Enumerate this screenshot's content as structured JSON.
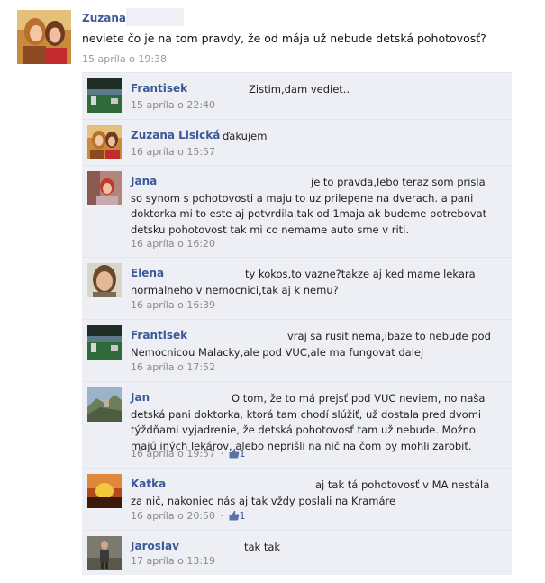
{
  "post": {
    "author": "Zuzana",
    "text": "neviete čo je na tom pravdy, že od mája už nebude detská pohotovosť?",
    "timestamp": "15 apríla o 19:38"
  },
  "comments": [
    {
      "author": "Frantisek",
      "text": "Zistim,dam vediet..",
      "timestamp": "15 apríla o 22:40"
    },
    {
      "author": "Zuzana Lisická",
      "text": "ďakujem",
      "timestamp": "16 apríla o 15:57"
    },
    {
      "author": "Jana",
      "text": "je to pravda,lebo teraz som prisla so synom s pohotovosti a maju to uz prilepene na dverach. a pani doktorka mi to este aj potvrdila.tak od 1maja ak budeme potrebovat detsku pohotovost tak mi co nemame auto sme v riti.",
      "timestamp": "16 apríla o 16:20"
    },
    {
      "author": "Elena",
      "text": "ty kokos,to vazne?takze aj ked mame lekara normalneho v nemocnici,tak aj k nemu?",
      "timestamp": "16 apríla o 16:39"
    },
    {
      "author": "Frantisek",
      "text": "vraj sa rusit nema,ibaze to nebude pod Nemocnicou Malacky,ale pod VUC,ale ma fungovat dalej",
      "timestamp": "16 apríla o 17:52"
    },
    {
      "author": "Jan",
      "text": "O tom, že to má prejsť pod VUC neviem, no naša detská pani doktorka, ktorá tam chodí slúžiť, už dostala pred dvomi týždňami vyjadrenie, že detská pohotovosť tam už nebude. Možno majú iných lekárov, alebo neprišli na nič na čom by mohli zarobiť.",
      "timestamp": "16 apríla o 19:57",
      "likes": "1"
    },
    {
      "author": "Katka",
      "text": "aj tak tá pohotovosť v MA nestála za nič, nakoniec nás aj tak vždy poslali na Kramáre",
      "timestamp": "16 apríla o 20:50",
      "likes": "1"
    },
    {
      "author": "Jaroslav",
      "text": "tak tak",
      "timestamp": "17 apríla o 13:19"
    }
  ],
  "icons": {
    "like": "thumbs-up-icon"
  },
  "colors": {
    "link": "#3b5998",
    "comment_bg": "#edeff4",
    "timestamp": "#8a8a8a"
  }
}
